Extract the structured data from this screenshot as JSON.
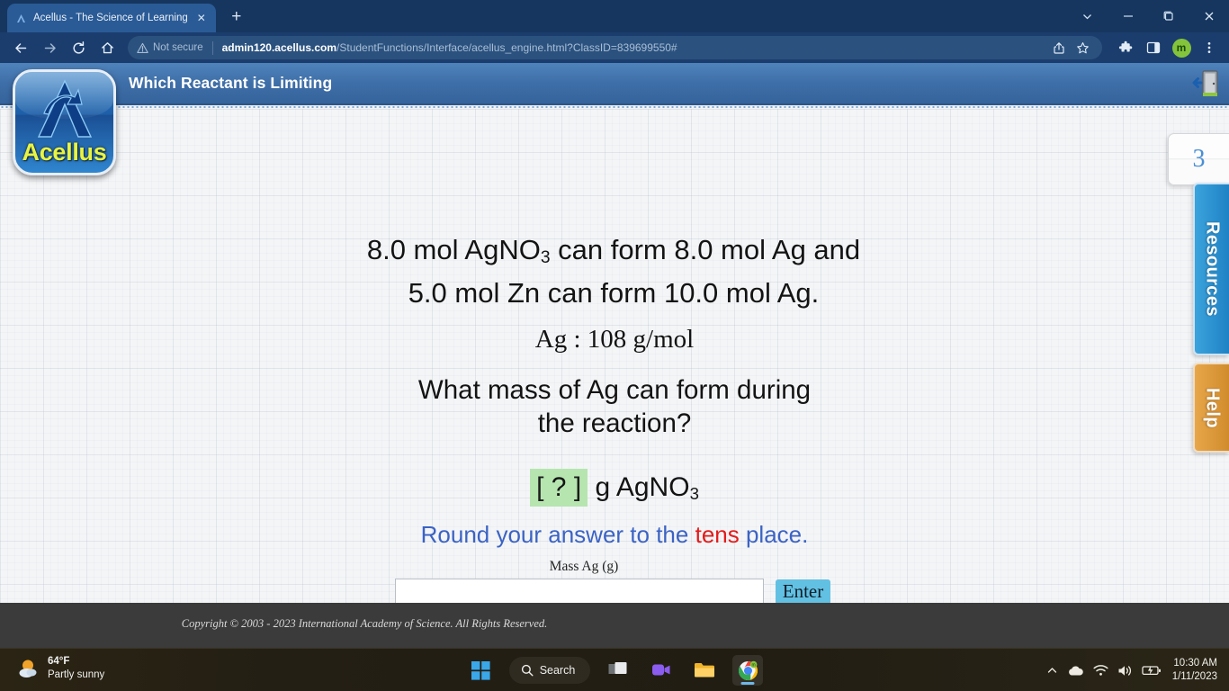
{
  "browser": {
    "tab": {
      "title": "Acellus - The Science of Learning",
      "favicon": "acellus-favicon",
      "close": "✕"
    },
    "new_tab_label": "+",
    "window_controls": {
      "minimize": "—",
      "maximize": "❐",
      "close": "✕",
      "chevron": "⌄"
    },
    "nav": {
      "back": "←",
      "forward": "→",
      "reload": "↻",
      "home": "⌂"
    },
    "security_label": "Not secure",
    "url_domain": "admin120.acellus.com",
    "url_path": "/StudentFunctions/Interface/acellus_engine.html?ClassID=839699550#",
    "profile_initial": "m"
  },
  "acellus": {
    "header_title": "Which Reactant is Limiting",
    "logo_word": "Acellus",
    "exit_icon": "exit-door-icon",
    "counter": "3",
    "rail": {
      "resources": "Resources",
      "help": "Help"
    },
    "copyright": "Copyright © 2003 - 2023 International Academy of Science.  All Rights Reserved."
  },
  "question": {
    "stoich_line1_pre": "8.0 mol AgNO",
    "stoich_line1_sub": "3",
    "stoich_line1_post": " can form 8.0 mol Ag and",
    "stoich_line2": "5.0 mol Zn can form 10.0 mol Ag.",
    "molar_mass": "Ag :  108 g/mol",
    "ask_line1": "What mass of Ag can form during",
    "ask_line2": "the reaction?",
    "blank_open": "[",
    "blank_value": "?",
    "blank_close": "]",
    "blank_unit_pre": " g AgNO",
    "blank_unit_sub": "3",
    "round_pre": "Round your answer to the ",
    "round_highlight": "tens",
    "round_post": " place.",
    "answer_label": "Mass Ag (g)",
    "answer_value": "",
    "answer_placeholder": "",
    "enter_label": "Enter"
  },
  "taskbar": {
    "weather_temp": "64°F",
    "weather_desc": "Partly sunny",
    "search_label": "Search",
    "icons": [
      "start-icon",
      "task-view-icon",
      "chat-icon",
      "file-explorer-icon",
      "chrome-icon"
    ],
    "time": "10:30 AM",
    "date": "1/11/2023"
  },
  "colors": {
    "accent_blue": "#3b63c4",
    "highlight_red": "#e31b1b",
    "green_blank": "#b6e5b0",
    "enter_button": "#62c0e3",
    "header_blue": "#3f6fa8"
  }
}
